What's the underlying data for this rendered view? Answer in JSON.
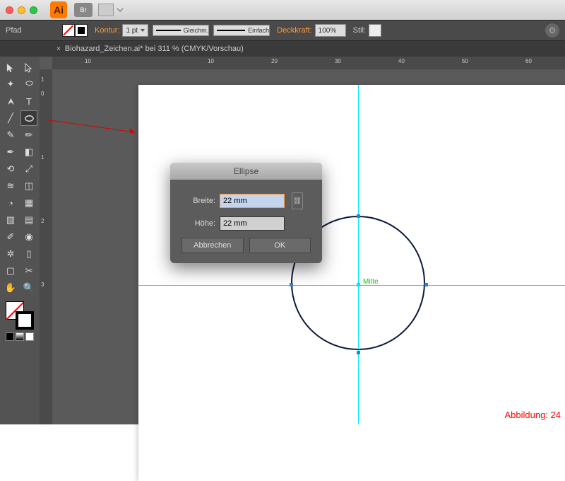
{
  "titlebar": {
    "app": "Ai",
    "br": "Br"
  },
  "control": {
    "pfad": "Pfad",
    "kontur": "Kontur:",
    "strokeWeight": "1 pt",
    "profile1": "Gleichm.",
    "profile2": "Einfach",
    "deckkraft": "Deckkraft:",
    "opacity": "100%",
    "stil": "Stil:"
  },
  "tab": {
    "close": "×",
    "title": "Biohazard_Zeichen.ai* bei 311 % (CMYK/Vorschau)"
  },
  "ruler": {
    "h": [
      "10",
      "10",
      "20",
      "30",
      "40",
      "50",
      "60"
    ],
    "v": [
      "1",
      "0",
      "1",
      "2",
      "3"
    ]
  },
  "canvas": {
    "mitte": "Mitte",
    "abbildung": "Abbildung: 24"
  },
  "dialog": {
    "title": "Ellipse",
    "breiteLbl": "Breite:",
    "breiteVal": "22 mm",
    "hoeheLbl": "Höhe:",
    "hoeheVal": "22 mm",
    "cancel": "Abbrechen",
    "ok": "OK"
  }
}
